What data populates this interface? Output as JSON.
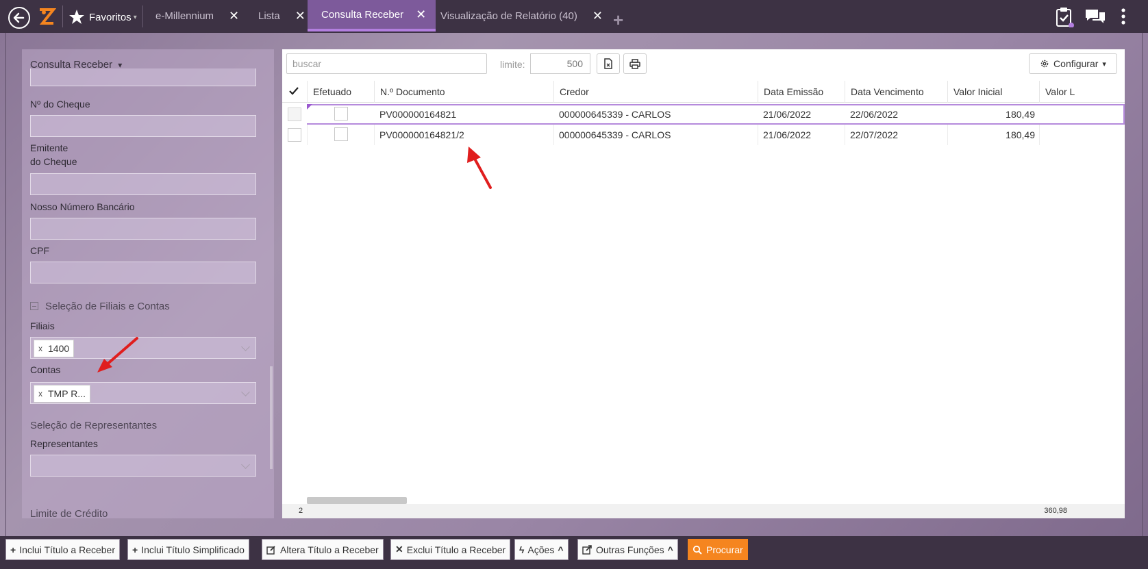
{
  "topbar": {
    "favorites_label": "Favoritos",
    "tabs": [
      {
        "label": "e-Millennium"
      },
      {
        "label": "Lista"
      },
      {
        "label": "Consulta Receber"
      },
      {
        "label": "Visualização de Relatório (40)"
      }
    ]
  },
  "filters": {
    "title": "Consulta Receber",
    "fields": {
      "cheque_num": "Nº do Cheque",
      "emitente_1": "Emitente",
      "emitente_2": "do Cheque",
      "nosso_numero": "Nosso Número Bancário",
      "cpf": "CPF"
    },
    "section_filiais": "Seleção de Filiais e Contas",
    "filiais_label": "Filiais",
    "filiais_chip": "1400",
    "contas_label": "Contas",
    "contas_chip": "TMP R...",
    "chip_remove": "x",
    "section_representantes": "Seleção de Representantes",
    "representantes_label": "Representantes",
    "section_limite": "Limite de Crédito"
  },
  "toolbar": {
    "search_placeholder": "buscar",
    "limite_label": "limite:",
    "limite_value": "500",
    "configurar_label": "Configurar"
  },
  "grid": {
    "columns": [
      "Efetuado",
      "N.º Documento",
      "Credor",
      "Data Emissão",
      "Data Vencimento",
      "Valor Inicial",
      "Valor L"
    ],
    "rows": [
      {
        "documento": "PV000000164821",
        "credor": "000000645339 - CARLOS",
        "emissao": "21/06/2022",
        "vencimento": "22/06/2022",
        "valor": "180,49"
      },
      {
        "documento": "PV000000164821/2",
        "credor": "000000645339 - CARLOS",
        "emissao": "21/06/2022",
        "vencimento": "22/07/2022",
        "valor": "180,49"
      }
    ],
    "footer_count": "2",
    "footer_sum": "360,98"
  },
  "bottom_bar": {
    "buttons": [
      {
        "label": "Inclui Título a Receber"
      },
      {
        "label": "Inclui Título Simplificado"
      },
      {
        "label": "Altera Título a Receber"
      },
      {
        "label": "Exclui Título a Receber"
      },
      {
        "label": "Ações"
      },
      {
        "label": "Outras Funções"
      },
      {
        "label": "Procurar"
      }
    ]
  },
  "colors": {
    "accent": "#7d5a9b",
    "topbar": "#3d3244",
    "primary_button": "#f5851f",
    "annotation": "#e01e1e"
  }
}
